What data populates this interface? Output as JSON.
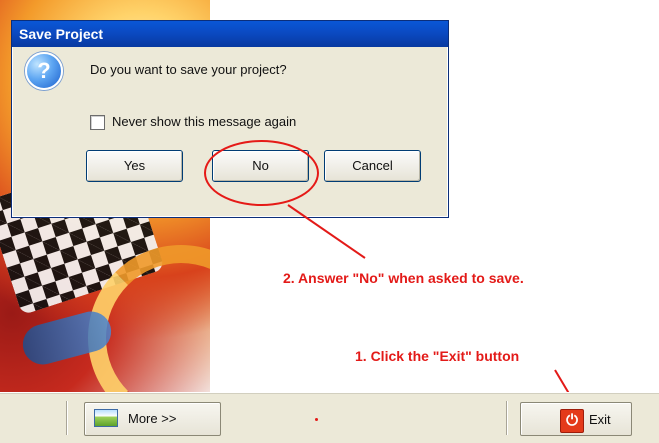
{
  "dialog": {
    "title": "Save Project",
    "question_icon": "question-icon",
    "message": "Do you want to save your project?",
    "checkbox_label": "Never show this message again",
    "checkbox_checked": false,
    "buttons": {
      "yes": "Yes",
      "no": "No",
      "cancel": "Cancel"
    }
  },
  "annotations": {
    "step2": "2. Answer \"No\" when asked to save.",
    "step1": "1. Click the \"Exit\" button",
    "color": "#e31a18"
  },
  "taskbar": {
    "more_label": "More >>",
    "more_icon": "image-icon",
    "exit_label": "Exit",
    "exit_icon": "power-icon"
  }
}
